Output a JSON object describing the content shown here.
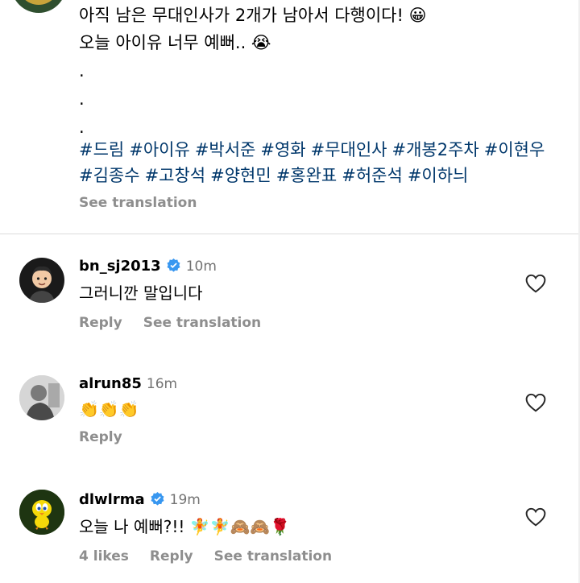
{
  "caption": {
    "line1": "아직 남은 무대인사가 2개가 남아서 다행이다! 😀",
    "line2": "오늘 아이유 너무 예뻐.. 😭",
    "dots": [
      ".",
      ".",
      "."
    ],
    "hashtags_row1": [
      "#드림",
      "#아이유",
      "#박서준",
      "#영화",
      "#무대인사",
      "#개봉2주차",
      "#이현우"
    ],
    "hashtags_row2": [
      "#김종수",
      "#고창석",
      "#양현민",
      "#홍완표",
      "#허준석",
      "#이하늬"
    ],
    "see_translation": "See translation"
  },
  "comments": [
    {
      "username": "bn_sj2013",
      "verified": true,
      "time": "10m",
      "text": "그러니깐 말입니다",
      "actions": [
        "Reply",
        "See translation"
      ]
    },
    {
      "username": "alrun85",
      "verified": false,
      "time": "16m",
      "text": "👏👏👏",
      "actions": [
        "Reply"
      ]
    },
    {
      "username": "dlwlrma",
      "verified": true,
      "time": "19m",
      "text": "오늘 나 예뻐?!! 🧚🧚🙈🙈🌹",
      "actions": [
        "4 likes",
        "Reply",
        "See translation"
      ]
    }
  ],
  "icons": {
    "like": "heart-outline-icon",
    "verified": "verified-badge-icon"
  },
  "colors": {
    "hashtag": "#00376b",
    "secondary": "#8e8e8e",
    "verified": "#3897f0"
  }
}
